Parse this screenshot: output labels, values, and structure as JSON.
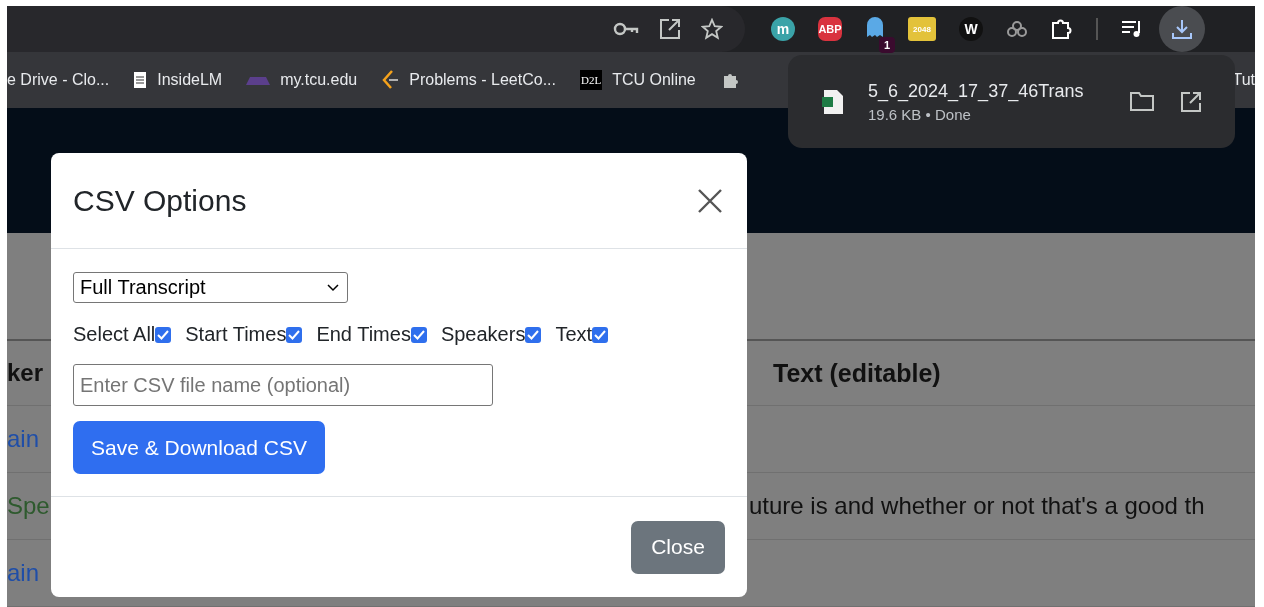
{
  "toolbar": {
    "extensions": [
      {
        "kind": "circle",
        "label": "m",
        "color": "#3aa3a8"
      },
      {
        "kind": "octagon",
        "label": "ABP",
        "color": "#d9333f"
      },
      {
        "kind": "ghost",
        "badge": "1",
        "color": "#5aa9e6"
      },
      {
        "kind": "square",
        "label": "2048",
        "color": "#e3c23a"
      },
      {
        "kind": "circle",
        "label": "W",
        "color": "#111111"
      },
      {
        "kind": "rings",
        "color": "#9a9a9a"
      }
    ]
  },
  "bookmarks": [
    {
      "kind": "none",
      "label": "e Drive - Clo..."
    },
    {
      "kind": "doc",
      "label": "InsideLM"
    },
    {
      "kind": "tcu",
      "label": "my.tcu.edu"
    },
    {
      "kind": "leetcode",
      "label": "Problems - LeetCo..."
    },
    {
      "kind": "d2l",
      "label": "TCU Online",
      "logo": "D2L"
    },
    {
      "kind": "puzzle"
    },
    {
      "kind": "none",
      "label": "Tut"
    }
  ],
  "download": {
    "file": "5_6_2024_17_37_46Trans",
    "info": "19.6 KB • Done"
  },
  "table": {
    "columns": [
      "ker",
      "Text (editable)"
    ],
    "rows": [
      {
        "speaker": "ain",
        "kind": "link"
      },
      {
        "speaker": "Spe",
        "kind": "green",
        "text": "uture is and whether or not that's a good th"
      },
      {
        "speaker": "ain",
        "kind": "link"
      }
    ]
  },
  "modal": {
    "title": "CSV Options",
    "select": "Full Transcript",
    "checkboxes": [
      {
        "label": "Select All",
        "checked": true
      },
      {
        "label": "Start Times",
        "checked": true
      },
      {
        "label": "End Times",
        "checked": true
      },
      {
        "label": "Speakers",
        "checked": true
      },
      {
        "label": "Text",
        "checked": true
      }
    ],
    "placeholder": "Enter CSV file name (optional)",
    "save_button": "Save & Download CSV",
    "close_button": "Close"
  }
}
